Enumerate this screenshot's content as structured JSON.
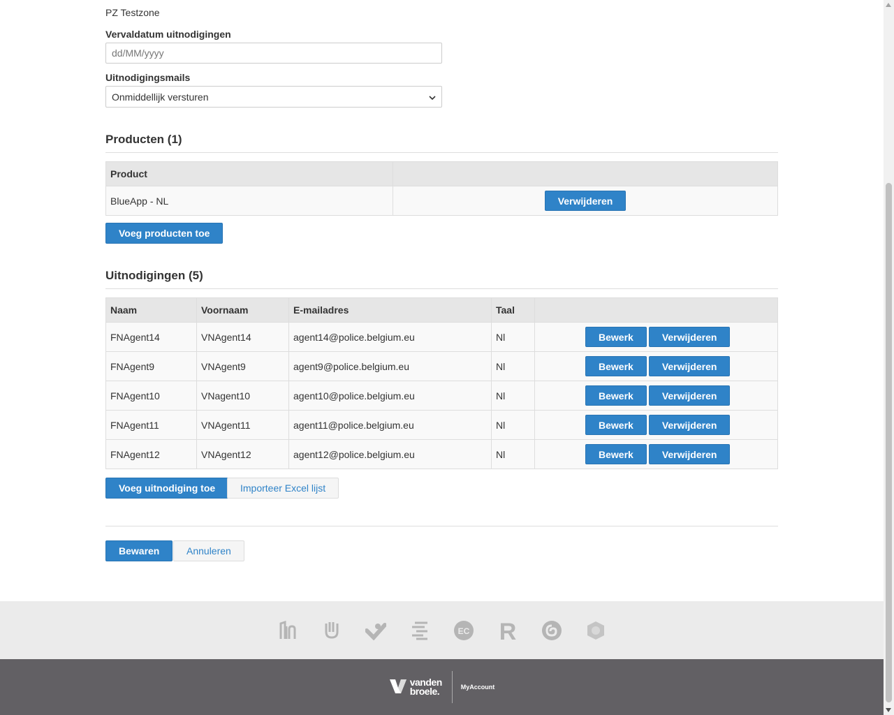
{
  "form": {
    "organisation_value": "PZ Testzone",
    "expiry": {
      "label": "Vervaldatum uitnodigingen",
      "placeholder": "dd/MM/yyyy",
      "value": ""
    },
    "mails": {
      "label": "Uitnodigingsmails",
      "selected": "Onmiddellijk versturen"
    }
  },
  "products": {
    "title": "Producten (1)",
    "columns": [
      "Product",
      ""
    ],
    "rows": [
      {
        "name": "BlueApp - NL",
        "remove_label": "Verwijderen"
      }
    ],
    "add_label": "Voeg producten toe"
  },
  "invitations": {
    "title": "Uitnodigingen (5)",
    "columns": [
      "Naam",
      "Voornaam",
      "E-mailadres",
      "Taal",
      ""
    ],
    "rows": [
      {
        "naam": "FNAgent14",
        "voornaam": "VNAgent14",
        "email": "agent14@police.belgium.eu",
        "taal": "Nl"
      },
      {
        "naam": "FNAgent9",
        "voornaam": "VNAgent9",
        "email": "agent9@police.belgium.eu",
        "taal": "Nl"
      },
      {
        "naam": "FNAgent10",
        "voornaam": "VNagent10",
        "email": "agent10@police.belgium.eu",
        "taal": "Nl"
      },
      {
        "naam": "FNAgent11",
        "voornaam": "VNAgent11",
        "email": "agent11@police.belgium.eu",
        "taal": "Nl"
      },
      {
        "naam": "FNAgent12",
        "voornaam": "VNAgent12",
        "email": "agent12@police.belgium.eu",
        "taal": "Nl"
      }
    ],
    "edit_label": "Bewerk",
    "remove_label": "Verwijderen",
    "add_label": "Voeg uitnodiging toe",
    "import_label": "Importeer Excel lijst"
  },
  "actions": {
    "save_label": "Bewaren",
    "cancel_label": "Annuleren"
  },
  "footer": {
    "brand_line1": "vanden",
    "brand_line2": "broele.",
    "myaccount": "MyAccount",
    "partner_icons": [
      "library-logo-icon",
      "hand-logo-icon",
      "check-heart-logo-icon",
      "lines-logo-icon",
      "ec-logo-icon",
      "r-logo-icon",
      "swirl-logo-icon",
      "shield-logo-icon"
    ],
    "ec_text": "EC",
    "r_text": "R"
  },
  "colors": {
    "primary": "#2f83c8",
    "footer_bg": "#626064",
    "logos_bg": "#ebebeb"
  }
}
